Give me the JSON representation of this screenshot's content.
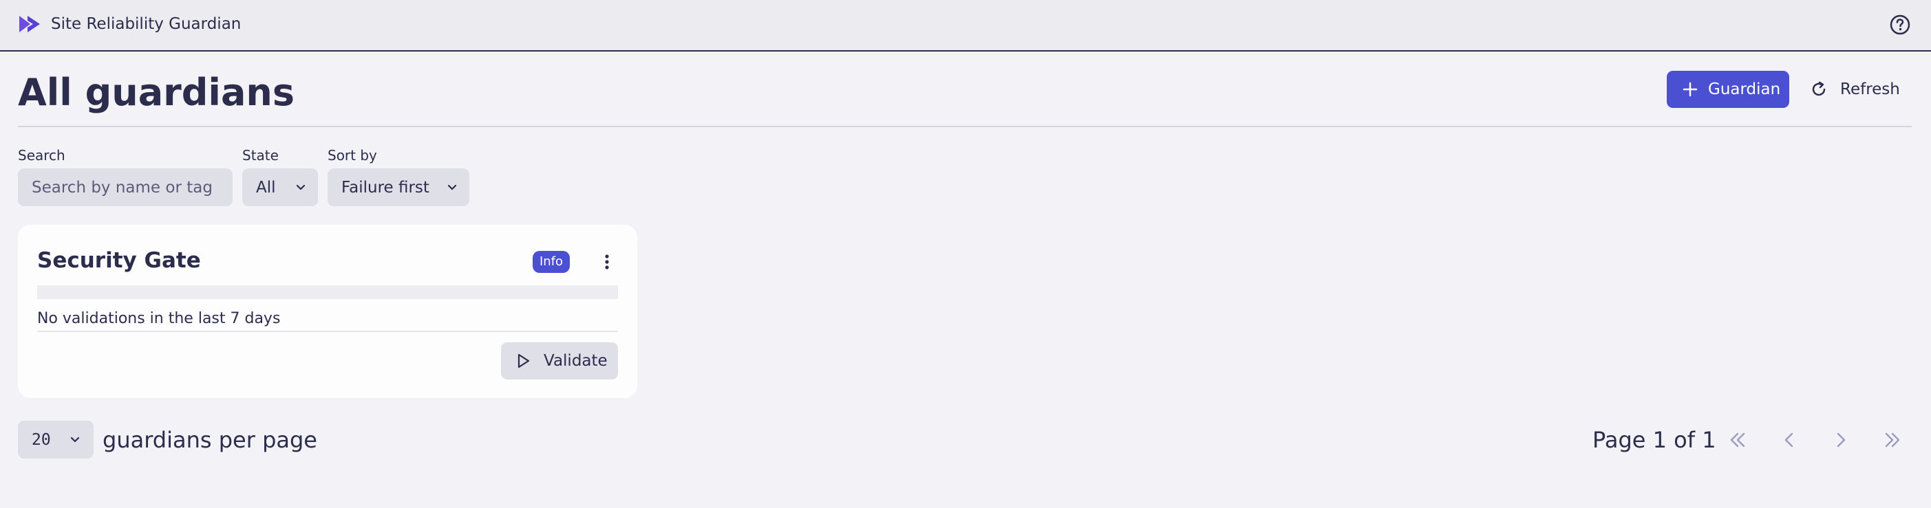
{
  "app": {
    "title": "Site Reliability Guardian",
    "logo_icon": "dynatrace-play-logo-icon",
    "help_icon": "help-circle-icon"
  },
  "header": {
    "page_title": "All guardians",
    "add_button": {
      "icon": "plus-icon",
      "label": "Guardian"
    },
    "refresh_button": {
      "icon": "refresh-icon",
      "label": "Refresh"
    }
  },
  "filters": {
    "search": {
      "label": "Search",
      "placeholder": "Search by name or tag",
      "value": ""
    },
    "state": {
      "label": "State",
      "value": "All"
    },
    "sort": {
      "label": "Sort by",
      "value": "Failure first"
    }
  },
  "guardians": [
    {
      "name": "Security Gate",
      "badge": "Info",
      "status": "No validations in the last 7 days",
      "validate_label": "Validate"
    }
  ],
  "pagination": {
    "per_page_value": "20",
    "per_page_label": "guardians per page",
    "page_text": "Page 1 of 1"
  },
  "colors": {
    "accent": "#4b4fd1",
    "text": "#2c2d4d",
    "background": "#f3f3f7",
    "card": "#fdfdfd",
    "control": "#dfdfe8",
    "disabled": "#9a9bc0"
  }
}
